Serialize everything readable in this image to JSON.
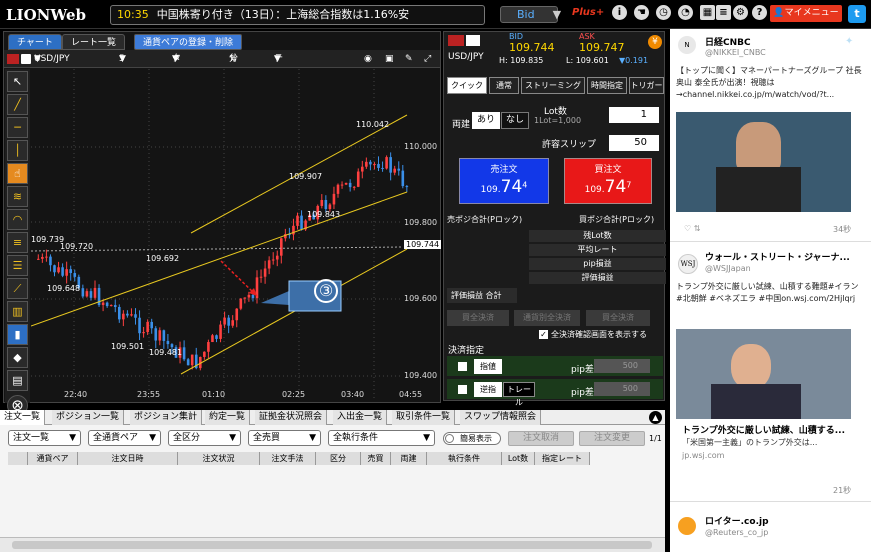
{
  "topbar": {
    "logo": "LIONWeb",
    "time": "10:35",
    "news": "中国株寄り付き（13日）：上海総合指数は1.16%安",
    "price_mode": "Bid",
    "plus_label": "Plus+",
    "my_menu": "マイメニュー",
    "twitter": "t"
  },
  "chart_panel": {
    "tabs": [
      "チャート",
      "レート一覧"
    ],
    "register_btn": "通貨ペアの登録・削除",
    "pair": "USD/JPY",
    "timeframe": "5分足",
    "type_label": "タイプ",
    "analysis_label": "分析",
    "technical_label": "テクニカル",
    "y_labels": [
      "110.000",
      "109.800",
      "109.600",
      "109.400"
    ],
    "y_current": "109.744",
    "x_labels": [
      "22:40",
      "23:55",
      "01:10",
      "02:25",
      "03:40",
      "04:55"
    ],
    "data_labels": [
      "110.042",
      "109.907",
      "109.843",
      "109.739",
      "109.720",
      "109.692",
      "109.648",
      "109.501",
      "109.481"
    ],
    "callout": "③"
  },
  "order_panel": {
    "pair": "USD/JPY",
    "bid_label": "BID",
    "ask_label": "ASK",
    "bid": "109.744",
    "ask": "109.747",
    "high_label": "H: 109.835",
    "low_label": "L: 109.601",
    "change": "▼0.191",
    "tabs": [
      "クイック",
      "通常",
      "ストリーミング",
      "時間指定",
      "トリガー"
    ],
    "ryodate_label": "両建",
    "ryodate_on": "あり",
    "ryodate_off": "なし",
    "lot_label": "Lot数",
    "lot_sub": "1Lot=1,000",
    "lot_value": "1",
    "slip_label": "許容スリップ",
    "slip_value": "50",
    "sell_label": "売注文",
    "sell_prefix": "109.",
    "sell_big": "74",
    "sell_sup": "4",
    "buy_label": "買注文",
    "buy_prefix": "109.",
    "buy_big": "74",
    "buy_sup": "7",
    "sell_pos": "売ポジ合計(Pロック)",
    "buy_pos": "買ポジ合計(Pロック)",
    "rows": [
      "残Lot数",
      "平均レート",
      "pip損益",
      "評価損益"
    ],
    "eval_total": "評価損益 合計",
    "settle_btns": [
      "買全決済",
      "通貨別全決済",
      "買全決済"
    ],
    "show_confirm": "全決済確認画面を表示する",
    "settle_spec": "決済指定",
    "limit_btn": "指値",
    "stop_btn": "逆指",
    "trail_btn": "トレール",
    "pip_diff": "pip差",
    "pip_value": "500"
  },
  "bottom": {
    "tabs": [
      "注文一覧",
      "ポジション一覧",
      "ポジション集計",
      "約定一覧",
      "証拠金状況照会",
      "入出金一覧",
      "取引条件一覧",
      "スワップ情報照会"
    ],
    "filters": [
      "注文一覧",
      "全通貨ペア",
      "全区分",
      "全売買",
      "全執行条件"
    ],
    "simple_label": "簡易表示",
    "cancel_btn": "注文取消",
    "modify_btn": "注文変更",
    "page": "1/1",
    "columns": [
      "通貨ペア",
      "注文日時",
      "注文状況",
      "注文手法",
      "区分",
      "売買",
      "両建",
      "執行条件",
      "Lot数",
      "指定レート"
    ]
  },
  "feed": {
    "tweets": [
      {
        "name": "日経CNBC",
        "handle": "@NIKKEI_CNBC",
        "text": "【トップに聞く】マネーパートナーズグループ 社長　奥山 泰全氏が出演！視聴は→channel.nikkei.co.jp/m/watch/vod/?t...",
        "time": "34秒"
      },
      {
        "name": "ウォール・ストリート・ジャーナ...",
        "handle": "@WSJJapan",
        "text": "トランプ外交に厳しい試練、山積する難題#イラン #北朝鮮 #ベネズエラ #中国on.wsj.com/2Hjlqrj",
        "card_title": "トランプ外交に厳しい試練、山積する...",
        "card_sub": "「米国第一主義」のトランプ外交は...",
        "card_url": "jp.wsj.com",
        "time": "21秒"
      },
      {
        "name": "ロイター.co.jp",
        "handle": "@Reuters_co_jp"
      }
    ]
  }
}
